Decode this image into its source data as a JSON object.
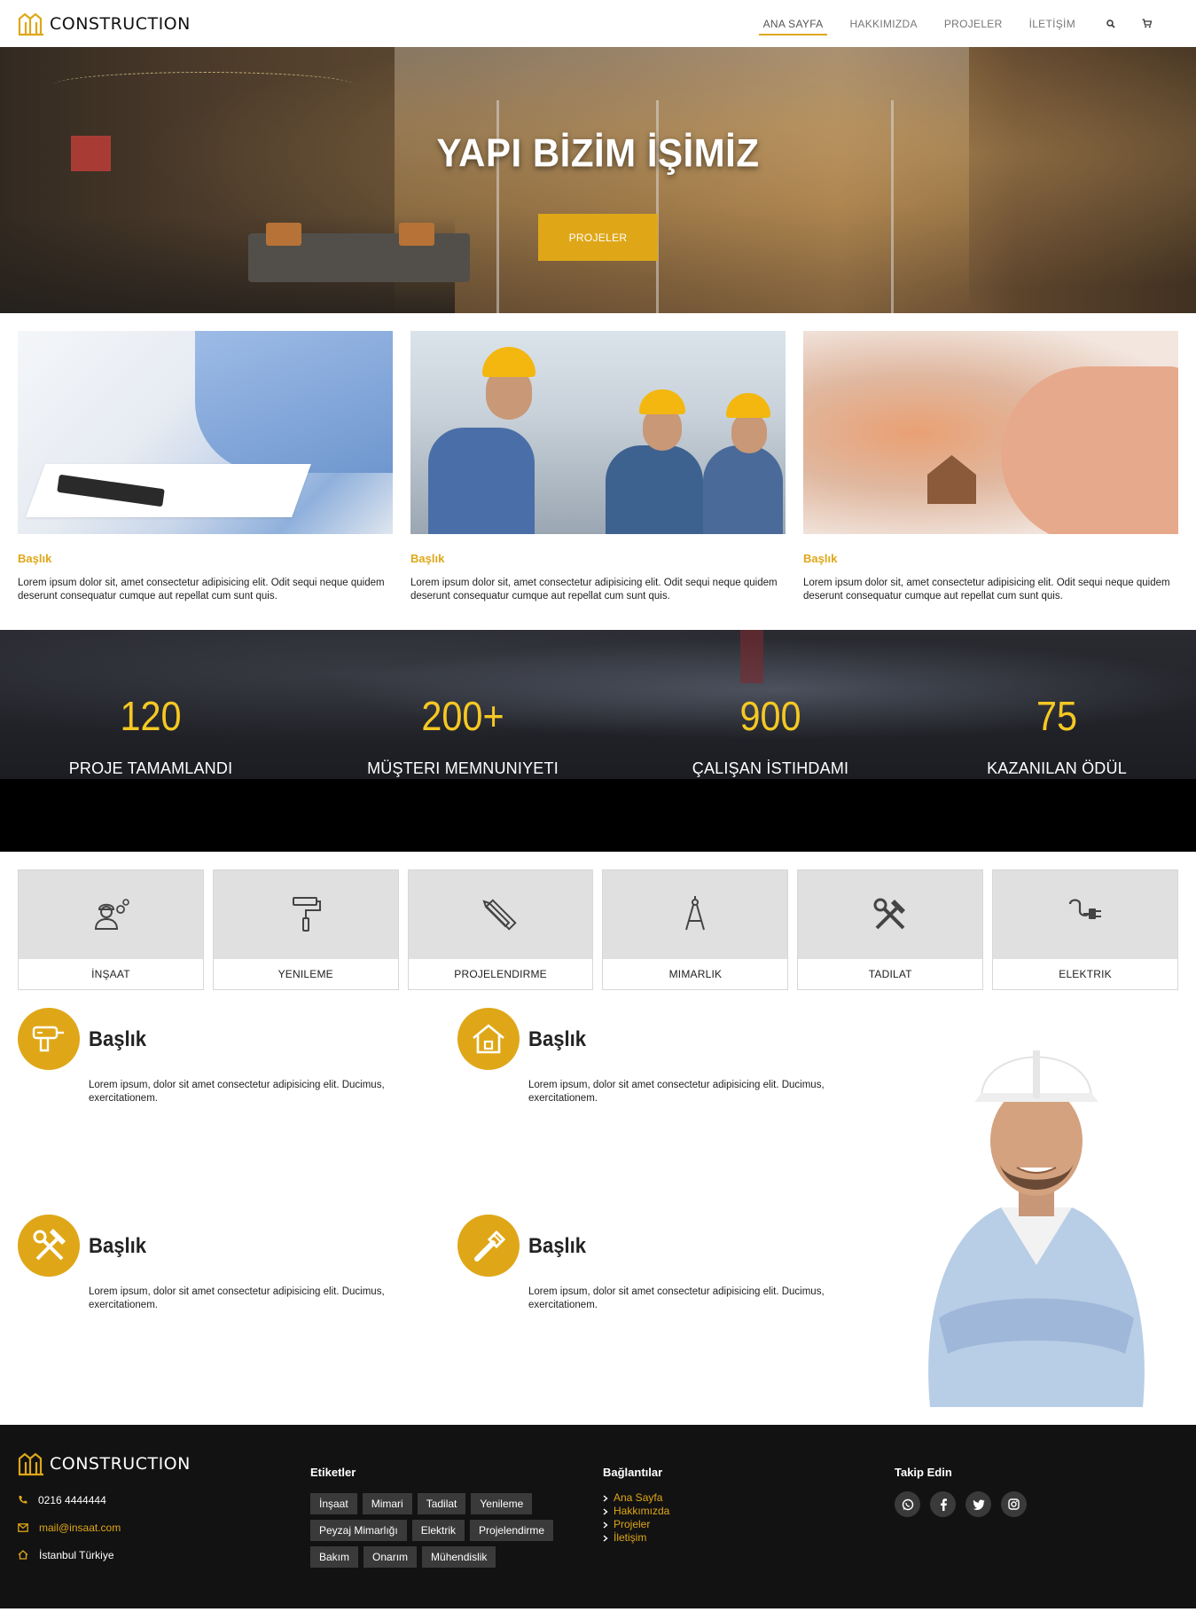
{
  "brand": {
    "name": "CONSTRUCTION",
    "accent": "#dfa718",
    "icon": "building-logo-icon"
  },
  "nav": {
    "items": [
      {
        "label": "ANA SAYFA",
        "active": true
      },
      {
        "label": "HAKKIMIZDA",
        "active": false
      },
      {
        "label": "PROJELER",
        "active": false
      },
      {
        "label": "İLETİŞİM",
        "active": false
      }
    ],
    "search_icon": "search-icon",
    "cart_icon": "cart-icon"
  },
  "hero": {
    "title": "YAPI BİZİM İŞİMİZ",
    "button": "PROJELER"
  },
  "cards": [
    {
      "title": "Başlık",
      "text": "Lorem ipsum dolor sit, amet consectetur adipisicing elit. Odit sequi neque quidem deserunt consequatur cumque aut repellat cum sunt quis."
    },
    {
      "title": "Başlık",
      "text": "Lorem ipsum dolor sit, amet consectetur adipisicing elit. Odit sequi neque quidem deserunt consequatur cumque aut repellat cum sunt quis."
    },
    {
      "title": "Başlık",
      "text": "Lorem ipsum dolor sit, amet consectetur adipisicing elit. Odit sequi neque quidem deserunt consequatur cumque aut repellat cum sunt quis."
    }
  ],
  "stats": [
    {
      "value": "120",
      "label": "PROJE TAMAMLANDI"
    },
    {
      "value": "200+",
      "label": "MÜŞTERI MEMNUNIYETI"
    },
    {
      "value": "900",
      "label": "ÇALIŞAN İSTIHDAMI"
    },
    {
      "value": "75",
      "label": "KAZANILAN ÖDÜL"
    }
  ],
  "services": [
    {
      "label": "İNŞAAT",
      "icon": "worker-gears-icon"
    },
    {
      "label": "YENILEME",
      "icon": "paint-roller-icon"
    },
    {
      "label": "PROJELENDIRME",
      "icon": "ruler-pencil-icon"
    },
    {
      "label": "MIMARLIK",
      "icon": "compass-icon"
    },
    {
      "label": "TADILAT",
      "icon": "hammer-wrench-icon"
    },
    {
      "label": "ELEKTRIK",
      "icon": "plug-icon"
    }
  ],
  "features": [
    {
      "title": "Başlık",
      "text": "Lorem ipsum, dolor sit amet consectetur adipisicing elit. Ducimus, exercitationem.",
      "icon": "drill-icon"
    },
    {
      "title": "Başlık",
      "text": "Lorem ipsum, dolor sit amet consectetur adipisicing elit. Ducimus, exercitationem.",
      "icon": "house-icon"
    },
    {
      "title": "Başlık",
      "text": "Lorem ipsum, dolor sit amet consectetur adipisicing elit. Ducimus, exercitationem.",
      "icon": "tools-icon"
    },
    {
      "title": "Başlık",
      "text": "Lorem ipsum, dolor sit amet consectetur adipisicing elit. Ducimus, exercitationem.",
      "icon": "pipe-wrench-icon"
    }
  ],
  "footer": {
    "brand": "CONSTRUCTION",
    "phone": "0216 4444444",
    "email": "mail@insaat.com",
    "address": "İstanbul Türkiye",
    "tags_heading": "Etiketler",
    "tags": [
      "İnşaat",
      "Mimari",
      "Tadilat",
      "Yenileme",
      "Peyzaj Mimarlığı",
      "Elektrik",
      "Projelendirme",
      "Bakım",
      "Onarım",
      "Mühendislik"
    ],
    "links_heading": "Bağlantılar",
    "links": [
      "Ana Sayfa",
      "Hakkımızda",
      "Projeler",
      "İletişim"
    ],
    "social_heading": "Takip Edin",
    "socials": [
      "whatsapp-icon",
      "facebook-icon",
      "twitter-icon",
      "instagram-icon"
    ]
  }
}
